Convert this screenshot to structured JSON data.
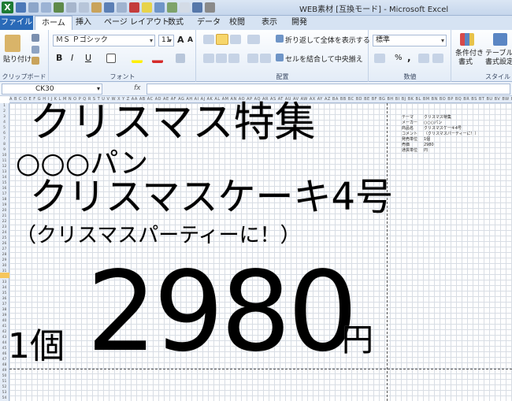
{
  "window": {
    "title": "WEB素材 [互換モード] - Microsoft Excel"
  },
  "tabs": [
    "ファイル",
    "ホーム",
    "挿入",
    "ページ レイアウト",
    "数式",
    "データ",
    "校閲",
    "表示",
    "開発"
  ],
  "ribbon": {
    "clipboard": {
      "paste": "貼り付け",
      "label": "クリップボード"
    },
    "font": {
      "name": "ＭＳ Ｐゴシック",
      "size": "11",
      "label": "フォント",
      "bold": "B",
      "italic": "I",
      "underline": "U",
      "grow": "A",
      "shrink": "A"
    },
    "alignment": {
      "wrap": "折り返して全体を表示する",
      "merge": "セルを結合して中央揃え",
      "label": "配置"
    },
    "number": {
      "format": "標準",
      "percent": "%",
      "comma": ",",
      "label": "数値"
    },
    "styles": {
      "conditional": "条件付き",
      "conditional2": "書式",
      "table": "テーブルと",
      "table2": "書式設定",
      "label": "スタイル"
    }
  },
  "formula_bar": {
    "name_box": "CK30",
    "fx": "fx",
    "formula": ""
  },
  "sheet": {
    "title": "クリスマス特集",
    "maker": "○○○パン",
    "product": "クリスマスケーキ4号",
    "comment": "（クリスマスパーティーに！）",
    "qty": "1個",
    "price": "2980",
    "yen": "円"
  },
  "side_table": [
    {
      "k": "テーマ",
      "v": "クリスマス特集"
    },
    {
      "k": "メーカー",
      "v": "○○○パン"
    },
    {
      "k": "商品名",
      "v": "クリスマスケーキ4号"
    },
    {
      "k": "コメント",
      "v": "（クリスマスパーティーに！）"
    },
    {
      "k": "発売単位",
      "v": "1個"
    },
    {
      "k": "売価",
      "v": "2980"
    },
    {
      "k": "通貨単位",
      "v": "円"
    }
  ],
  "colors": {
    "file_tab": "#2a6ab8",
    "excel_green": "#1e7b34",
    "highlight": "#f6c65b"
  }
}
